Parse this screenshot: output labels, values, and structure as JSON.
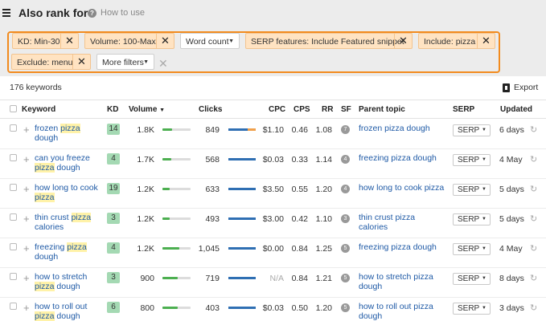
{
  "header": {
    "title": "Also rank for",
    "help_label": "How to use"
  },
  "filters": {
    "chips": [
      {
        "label": "KD: Min-30",
        "active": true
      },
      {
        "label": "Volume: 100-Max",
        "active": true
      },
      {
        "label": "Word count",
        "active": false
      },
      {
        "label": "SERP features: Include Featured snippet",
        "active": true
      },
      {
        "label": "Include: pizza",
        "active": true
      },
      {
        "label": "Exclude: menu",
        "active": true
      },
      {
        "label": "More filters",
        "active": false
      }
    ],
    "accent_color": "#f28b1e"
  },
  "toolbar": {
    "keyword_count": "176 keywords",
    "export_label": "Export"
  },
  "table": {
    "columns": [
      "Keyword",
      "KD",
      "Volume",
      "Clicks",
      "CPC",
      "CPS",
      "RR",
      "SF",
      "Parent topic",
      "SERP",
      "Updated"
    ],
    "rows": [
      {
        "kw1": "frozen ",
        "kw1h": "pizza",
        "kw2": "",
        "kw2h": "",
        "kw3": "dough",
        "kd": "14",
        "volume": "1.8K",
        "volume_level": 0.35,
        "clicks": "849",
        "clicks_orange_share": 0.3,
        "cpc": "$1.10",
        "cps": "0.46",
        "rr": "1.08",
        "sf": "7",
        "parent": "frozen pizza dough",
        "serp": "SERP",
        "updated": "6 days"
      },
      {
        "kw1": "can you freeze",
        "kw1h": "",
        "kw2": "",
        "kw2h": "pizza",
        "kw3": " dough",
        "kd": "4",
        "volume": "1.7K",
        "volume_level": 0.3,
        "clicks": "568",
        "clicks_orange_share": 0.0,
        "cpc": "$0.03",
        "cps": "0.33",
        "rr": "1.14",
        "sf": "4",
        "parent": "freezing pizza dough",
        "serp": "SERP",
        "updated": "4 May"
      },
      {
        "kw1": "how long to cook",
        "kw1h": "",
        "kw2": "",
        "kw2h": "pizza",
        "kw3": "",
        "kd": "19",
        "volume": "1.2K",
        "volume_level": 0.25,
        "clicks": "633",
        "clicks_orange_share": 0.0,
        "cpc": "$3.50",
        "cps": "0.55",
        "rr": "1.20",
        "sf": "4",
        "parent": "how long to cook pizza",
        "serp": "SERP",
        "updated": "5 days"
      },
      {
        "kw1": "thin crust ",
        "kw1h": "pizza",
        "kw2": "",
        "kw2h": "",
        "kw3": "calories",
        "kd": "3",
        "volume": "1.2K",
        "volume_level": 0.25,
        "clicks": "493",
        "clicks_orange_share": 0.0,
        "cpc": "$3.00",
        "cps": "0.42",
        "rr": "1.10",
        "sf": "3",
        "parent": "thin crust pizza calories",
        "serp": "SERP",
        "updated": "5 days"
      },
      {
        "kw1": "freezing ",
        "kw1h": "pizza",
        "kw2": "",
        "kw2h": "",
        "kw3": "dough",
        "kd": "4",
        "volume": "1.2K",
        "volume_level": 0.6,
        "clicks": "1,045",
        "clicks_orange_share": 0.0,
        "cpc": "$0.00",
        "cps": "0.84",
        "rr": "1.25",
        "sf": "5",
        "parent": "freezing pizza dough",
        "serp": "SERP",
        "updated": "4 May"
      },
      {
        "kw1": "how to stretch",
        "kw1h": "",
        "kw2": "",
        "kw2h": "pizza",
        "kw3": " dough",
        "kd": "3",
        "volume": "900",
        "volume_level": 0.55,
        "clicks": "719",
        "clicks_orange_share": 0.0,
        "cpc": "N/A",
        "cps": "0.84",
        "rr": "1.21",
        "sf": "5",
        "parent": "how to stretch pizza dough",
        "serp": "SERP",
        "updated": "8 days"
      },
      {
        "kw1": "how to roll out",
        "kw1h": "",
        "kw2": "",
        "kw2h": "pizza",
        "kw3": " dough",
        "kd": "6",
        "volume": "800",
        "volume_level": 0.55,
        "clicks": "403",
        "clicks_orange_share": 0.0,
        "cpc": "$0.03",
        "cps": "0.50",
        "rr": "1.20",
        "sf": "5",
        "parent": "how to roll out pizza dough",
        "serp": "SERP",
        "updated": "3 days"
      }
    ]
  },
  "icons": {
    "menu": "hamburger-icon",
    "help": "question-circle-icon",
    "remove": "close-icon",
    "export": "export-icon",
    "refresh": "refresh-icon",
    "add": "plus-icon"
  }
}
